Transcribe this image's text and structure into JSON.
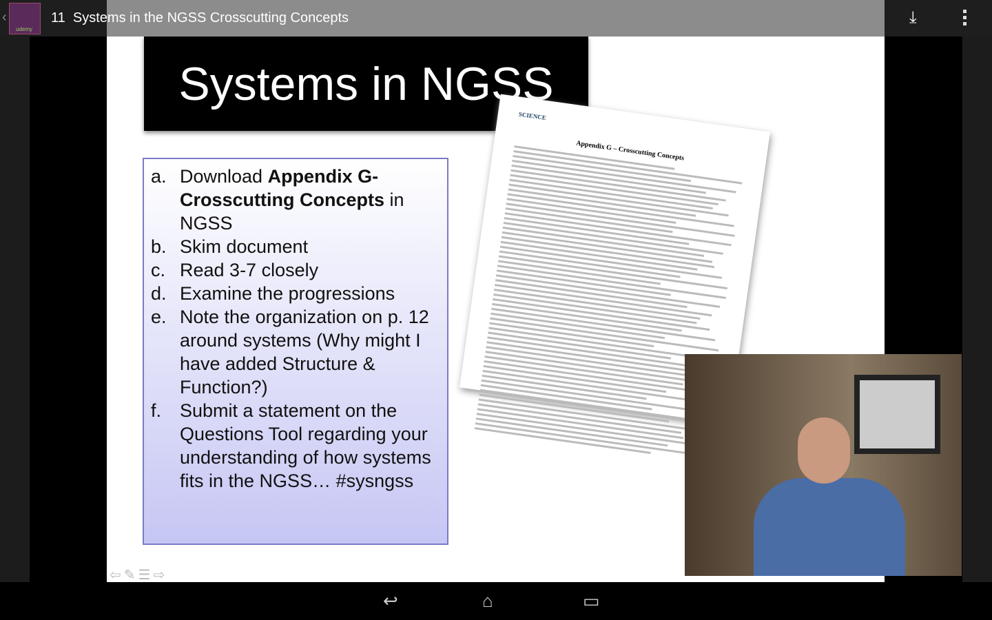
{
  "app": {
    "lesson_number": "11",
    "title": "Systems in the NGSS Crosscutting Concepts",
    "logo_text": "udemy",
    "icons": [
      "back-chevron-icon",
      "download-icon",
      "overflow-menu-icon"
    ]
  },
  "slide": {
    "title": "Systems in NGSS",
    "items": [
      {
        "key": "a.",
        "pre": "Download ",
        "bold": "Appendix G-Crosscutting Concepts",
        "post": " in NGSS"
      },
      {
        "key": "b.",
        "pre": "Skim document"
      },
      {
        "key": "c.",
        "pre": "Read 3-7 closely"
      },
      {
        "key": "d.",
        "pre": "Examine the progressions"
      },
      {
        "key": "e.",
        "pre": "Note the organization on p. 12 around systems (Why might I have added Structure & Function?)"
      },
      {
        "key": "f.",
        "pre": "Submit a statement on the Questions Tool regarding your understanding of how systems fits in the NGSS… #sysngss"
      }
    ],
    "document": {
      "logo": "SCIENCE",
      "heading": "Appendix G – Crosscutting Concepts"
    },
    "controls": [
      "prev-arrow-icon",
      "pen-icon",
      "notes-icon",
      "next-arrow-icon"
    ]
  },
  "navbar": {
    "icons": [
      "back-icon",
      "home-icon",
      "recent-apps-icon"
    ]
  }
}
